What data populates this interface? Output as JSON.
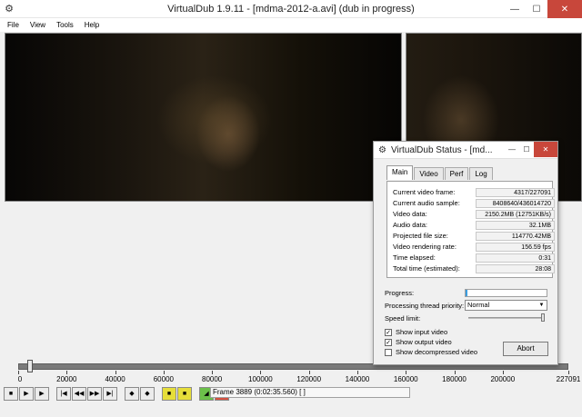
{
  "window": {
    "title": "VirtualDub 1.9.11 - [mdma-2012-a.avi] (dub in progress)",
    "minimize_glyph": "—",
    "maximize_glyph": "☐",
    "close_glyph": "✕"
  },
  "menu": [
    "File",
    "View",
    "Tools",
    "Help"
  ],
  "timeline": {
    "tick_labels": [
      "0",
      "20000",
      "40000",
      "60000",
      "80000",
      "100000",
      "120000",
      "140000",
      "160000",
      "180000",
      "200000",
      "227091"
    ],
    "frame_readout": "Frame 3889 (0:02:35.560) [ ]",
    "current_frame": 3889,
    "total_frames": 227091
  },
  "toolbar": {
    "buttons": [
      "stop",
      "play-input",
      "play-output",
      "go-start",
      "prev-keyframe",
      "next-keyframe",
      "go-end",
      "key-prev",
      "key-next",
      "scene-prev",
      "scene-next",
      "mark-in",
      "mark-out"
    ],
    "glyphs": [
      "■",
      "▶",
      "▶",
      "|◀",
      "◀◀",
      "▶▶",
      "▶|",
      "◆",
      "◆",
      "■",
      "■",
      "◢",
      "◣"
    ]
  },
  "status_dialog": {
    "title": "VirtualDub Status - [md...",
    "tabs": [
      "Main",
      "Video",
      "Perf",
      "Log"
    ],
    "active_tab": "Main",
    "stats": [
      {
        "label": "Current video frame:",
        "value": "4317/227091"
      },
      {
        "label": "Current audio sample:",
        "value": "8408640/436014720"
      },
      {
        "label": "Video data:",
        "value": "2150.2MB (12751KB/s)"
      },
      {
        "label": "Audio data:",
        "value": "32.1MB"
      },
      {
        "label": "Projected file size:",
        "value": "114770.42MB"
      },
      {
        "label": "Video rendering rate:",
        "value": "156.59 fps"
      },
      {
        "label": "Time elapsed:",
        "value": "0:31"
      },
      {
        "label": "Total time (estimated):",
        "value": "28:08"
      }
    ],
    "progress_label": "Progress:",
    "progress_fraction": 0.02,
    "priority_label": "Processing thread priority:",
    "priority_value": "Normal",
    "speed_label": "Speed limit:",
    "speed_level": 1.0,
    "checkboxes": [
      {
        "label": "Show input video",
        "checked": true
      },
      {
        "label": "Show output video",
        "checked": true
      },
      {
        "label": "Show decompressed video",
        "checked": false
      }
    ],
    "abort_label": "Abort"
  }
}
